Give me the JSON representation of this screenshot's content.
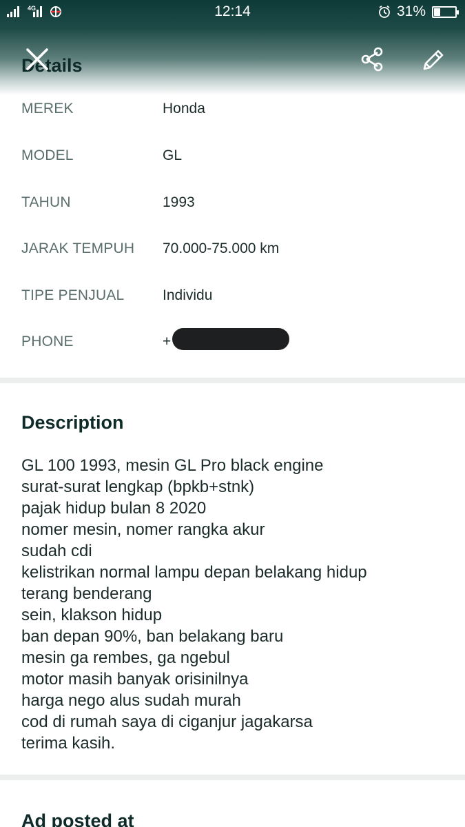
{
  "status_bar": {
    "time": "12:14",
    "battery_percent": "31%",
    "battery_level": 0.31,
    "network_label": "4G",
    "icons": [
      "signal-icon",
      "signal-4g-icon",
      "carrier-icon",
      "alarm-icon",
      "battery-icon"
    ]
  },
  "app_bar": {
    "title": "Details",
    "icons": [
      "close-icon",
      "share-icon",
      "edit-icon"
    ]
  },
  "details": [
    {
      "label": "MEREK",
      "value": "Honda"
    },
    {
      "label": "MODEL",
      "value": "GL"
    },
    {
      "label": "TAHUN",
      "value": "1993"
    },
    {
      "label": "JARAK TEMPUH",
      "value": "70.000-75.000 km"
    },
    {
      "label": "TIPE PENJUAL",
      "value": "Individu"
    },
    {
      "label": "PHONE",
      "value": "+"
    }
  ],
  "description": {
    "title": "Description",
    "lines": [
      "GL 100 1993, mesin GL Pro black engine",
      "surat-surat lengkap (bpkb+stnk)",
      "pajak hidup bulan 8 2020",
      "nomer mesin, nomer rangka akur",
      "sudah cdi",
      "kelistrikan normal lampu depan belakang hidup",
      "terang benderang",
      "sein, klakson hidup",
      "ban depan 90%, ban belakang baru",
      "mesin ga rembes, ga ngebul",
      "motor masih banyak orisinilnya",
      "harga nego alus sudah murah",
      "cod di rumah saya di ciganjur jagakarsa",
      "terima kasih."
    ]
  },
  "ad_posted": {
    "title": "Ad posted at"
  },
  "colors": {
    "header_dark": "#0d3a37",
    "title_text": "#0f2b29",
    "label_text": "#5a6e6c",
    "value_text": "#1b2b2a",
    "divider": "#eceeee"
  }
}
